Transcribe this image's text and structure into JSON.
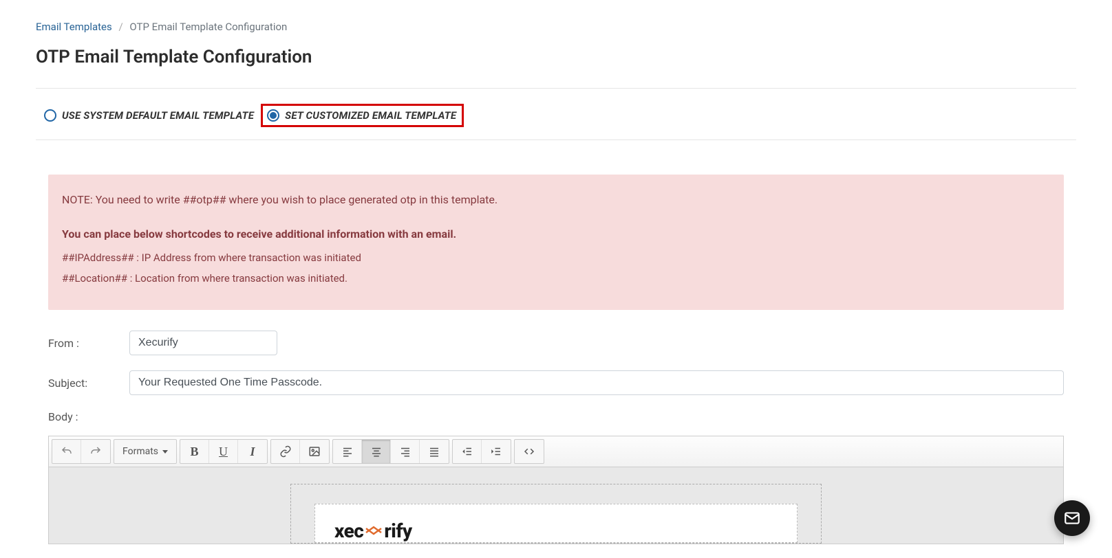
{
  "breadcrumb": {
    "parent": "Email Templates",
    "current": "OTP Email Template Configuration"
  },
  "page_title": "OTP Email Template Configuration",
  "radios": {
    "default_label": "USE SYSTEM DEFAULT EMAIL TEMPLATE",
    "custom_label": "SET CUSTOMIZED EMAIL TEMPLATE"
  },
  "alert": {
    "note": "NOTE: You need to write ##otp## where you wish to place generated otp in this template.",
    "bold": "You can place below shortcodes to receive additional information with an email.",
    "sc1": "##IPAddress## : IP Address from where transaction was initiated",
    "sc2": "##Location## : Location from where transaction was initiated."
  },
  "form": {
    "from_label": "From :",
    "from_value": "Xecurify",
    "subject_label": "Subject:",
    "subject_value": "Your Requested One Time Passcode.",
    "body_label": "Body :"
  },
  "toolbar": {
    "formats": "Formats"
  },
  "brand": {
    "pre": "xec",
    "post": "rify"
  }
}
